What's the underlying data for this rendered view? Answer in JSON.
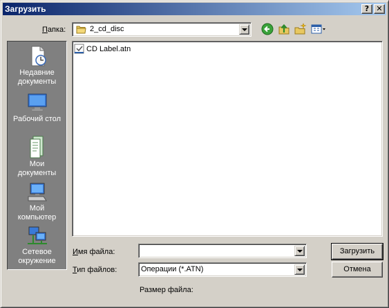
{
  "window": {
    "title": "Загрузить",
    "help_label": "?",
    "close_label": "✕"
  },
  "lookin": {
    "label_prefix": "",
    "label_u": "П",
    "label_rest": "апка:",
    "value": "2_cd_disc"
  },
  "toolbar": {
    "icons": [
      "back-icon",
      "up-folder-icon",
      "new-folder-icon",
      "views-menu-icon"
    ]
  },
  "places": [
    {
      "line1": "Недавние",
      "line2": "документы"
    },
    {
      "line1": "Рабочий стол",
      "line2": ""
    },
    {
      "line1": "Мои",
      "line2": "документы"
    },
    {
      "line1": "Мой",
      "line2": "компьютер"
    },
    {
      "line1": "Сетевое",
      "line2": "окружение"
    }
  ],
  "files": [
    {
      "name": "CD Label.atn"
    }
  ],
  "filename": {
    "label_u": "И",
    "label_rest": "мя файла:",
    "value": ""
  },
  "filetype": {
    "label_u": "Т",
    "label_rest": "ип файлов:",
    "value": "Операции (*.ATN)"
  },
  "buttons": {
    "open_label": "Загрузить",
    "cancel_label": "Отмена"
  },
  "filesize": {
    "label": "Размер файла:"
  },
  "colors": {
    "title_start": "#0a246a",
    "title_end": "#a6caf0",
    "face": "#d4d0c8",
    "places_bg": "#808080"
  }
}
